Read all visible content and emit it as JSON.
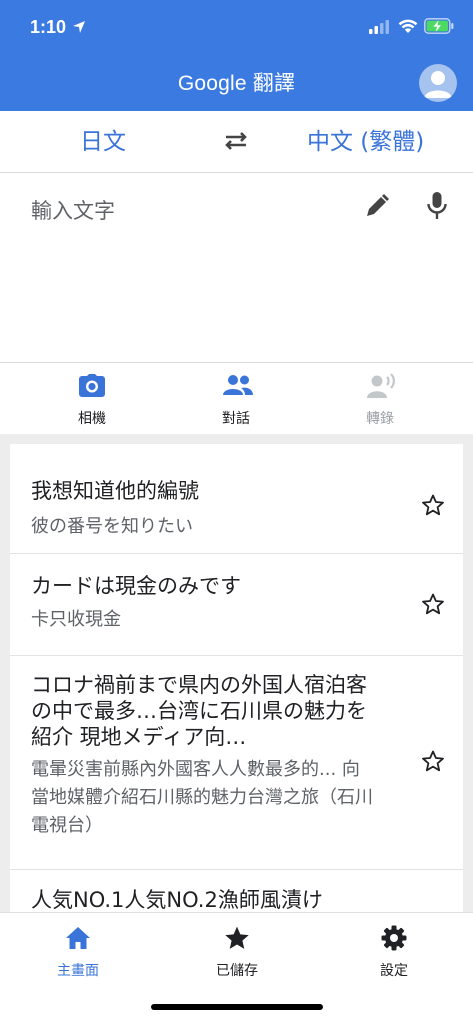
{
  "status_bar": {
    "time": "1:10"
  },
  "header": {
    "title": "Google 翻譯"
  },
  "languages": {
    "source": "日文",
    "target": "中文 (繁體)"
  },
  "input": {
    "placeholder": "輸入文字"
  },
  "tools": [
    {
      "label": "相機",
      "icon": "camera-icon"
    },
    {
      "label": "對話",
      "icon": "people-icon"
    },
    {
      "label": "轉錄",
      "icon": "transcribe-icon"
    }
  ],
  "history": [
    {
      "source": "我想知道他的編號",
      "translation": "彼の番号を知りたい"
    },
    {
      "source": "カードは現金のみです",
      "translation": "卡只收現金"
    },
    {
      "source": "コロナ禍前まで県内の外国人宿泊客の中で最多…台湾に石川県の魅力を紹介 現地メディア向…",
      "translation": "電暈災害前縣內外國客人人數最多的... 向當地媒體介紹石川縣的魅力台灣之旅（石川電視台）"
    },
    {
      "source": "人気NO.1人気NO.2漁師風漬け"
    }
  ],
  "bottom_nav": {
    "home": "主畫面",
    "saved": "已儲存",
    "settings": "設定"
  },
  "colors": {
    "primary": "#3b7ae0",
    "accent_text": "#3b74d9",
    "history_bg": "#ededed"
  }
}
